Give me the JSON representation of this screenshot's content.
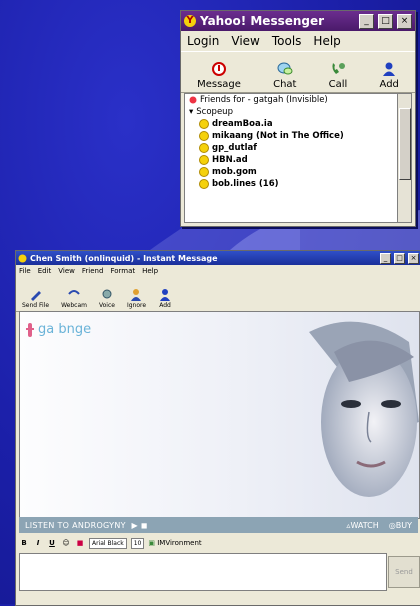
{
  "messenger": {
    "title": "Yahoo! Messenger",
    "menu": [
      "Login",
      "View",
      "Tools",
      "Help"
    ],
    "toolbar": [
      {
        "label": "Message",
        "icon": "message-icon"
      },
      {
        "label": "Chat",
        "icon": "chat-icon"
      },
      {
        "label": "Call",
        "icon": "call-icon"
      },
      {
        "label": "Add",
        "icon": "add-icon"
      }
    ],
    "friends_header": "Friends for - gatgah (Invisible)",
    "group": "Scopeup",
    "friends": [
      {
        "name": "dreamBoa.ia"
      },
      {
        "name": "mikaang (Not in The Office)"
      },
      {
        "name": "gp_dutlaf"
      },
      {
        "name": "HBN.ad"
      },
      {
        "name": "mob.gom"
      },
      {
        "name": "bob.lines (16)"
      }
    ]
  },
  "im": {
    "title": "Chen Smith (onlinquid) - Instant Message",
    "menu": [
      "File",
      "Edit",
      "View",
      "Friend",
      "Format",
      "Help"
    ],
    "toolbar": [
      {
        "label": "Send File",
        "icon": "send-file-icon"
      },
      {
        "label": "Webcam",
        "icon": "webcam-icon"
      },
      {
        "label": "Voice",
        "icon": "voice-icon"
      },
      {
        "label": "Ignore",
        "icon": "ignore-icon"
      },
      {
        "label": "Add",
        "icon": "add-icon"
      }
    ],
    "username": "ga bnge",
    "ad": {
      "listen": "LISTEN TO ANDROGYNY",
      "watch": "WATCH",
      "buy": "BUY"
    },
    "format": {
      "font": "Arial Black",
      "size": "10",
      "imvironment": "IMVironment"
    },
    "send_label": "Send"
  }
}
